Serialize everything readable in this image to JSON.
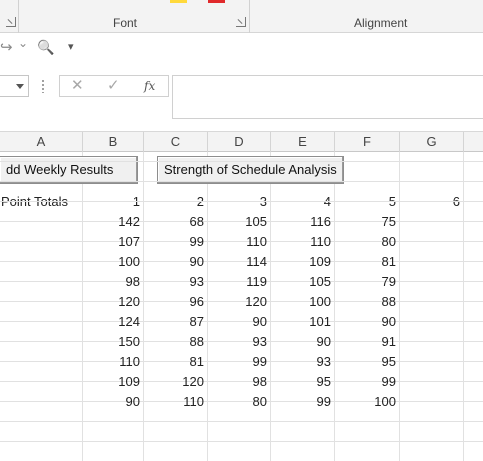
{
  "ribbon": {
    "font_group_label": "Font",
    "alignment_group_label": "Alignment",
    "launcher_icon": "dialog-launcher-icon",
    "swatch_colors": {
      "highlight": "#ffd93b",
      "font": "#e0292b"
    }
  },
  "qat": {
    "redo_icon": "↪",
    "redo_dropdown_icon": "⌄",
    "print_preview_icon": "🔍",
    "customize_icon": "▾"
  },
  "formula_bar": {
    "name_box_value": "",
    "cancel_icon": "✕",
    "enter_icon": "✓",
    "function_label": "fx",
    "formula_value": ""
  },
  "columns": [
    "A",
    "B",
    "C",
    "D",
    "E",
    "F",
    "G"
  ],
  "buttons": {
    "add_weekly_results": "dd Weekly Results",
    "strength_of_schedule": "Strength of Schedule Analysis"
  },
  "table": {
    "row_label": "Point Totals",
    "week_headers": [
      "1",
      "2",
      "3",
      "4",
      "5",
      "6"
    ],
    "rows": [
      [
        "142",
        "68",
        "105",
        "116",
        "75"
      ],
      [
        "107",
        "99",
        "110",
        "110",
        "80"
      ],
      [
        "100",
        "90",
        "114",
        "109",
        "81"
      ],
      [
        "98",
        "93",
        "119",
        "105",
        "79"
      ],
      [
        "120",
        "96",
        "120",
        "100",
        "88"
      ],
      [
        "124",
        "87",
        "90",
        "101",
        "90"
      ],
      [
        "150",
        "88",
        "93",
        "90",
        "91"
      ],
      [
        "110",
        "81",
        "99",
        "93",
        "95"
      ],
      [
        "109",
        "120",
        "98",
        "95",
        "99"
      ],
      [
        "90",
        "110",
        "80",
        "99",
        "100"
      ]
    ]
  }
}
